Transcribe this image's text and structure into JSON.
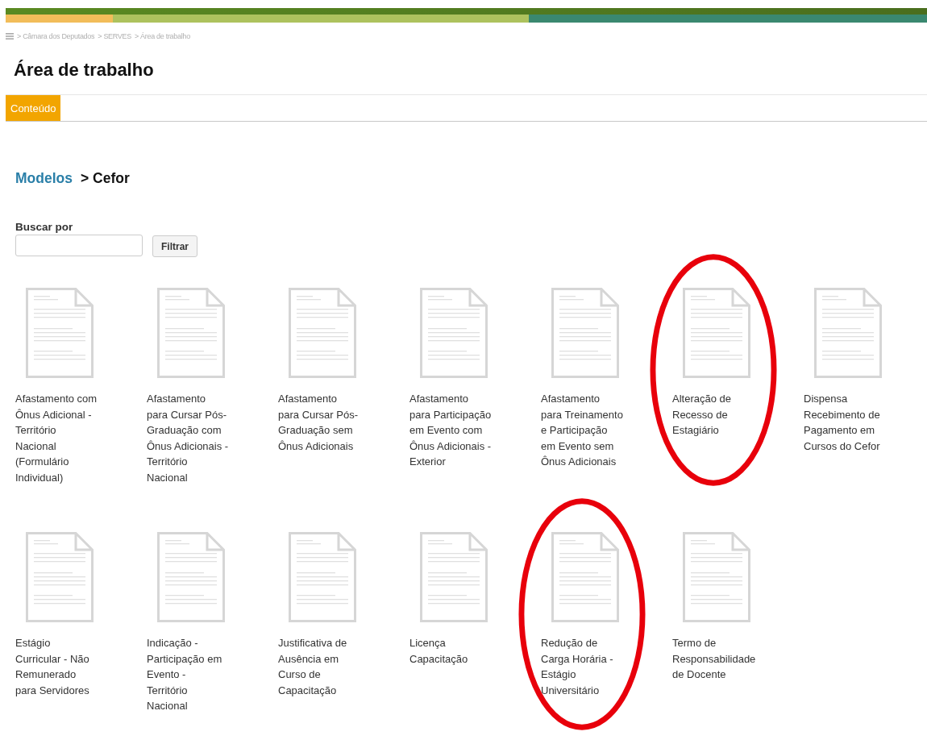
{
  "breadcrumb": [
    "> Câmara dos Deputados",
    "> SERVES",
    "> Área de trabalho"
  ],
  "title": "Área de trabalho",
  "tabs": [
    {
      "label": "Conteúdo",
      "selected": true
    }
  ],
  "path": {
    "link": "Modelos",
    "current": "> Cefor"
  },
  "search": {
    "label": "Buscar por",
    "button": "Filtrar"
  },
  "documents": [
    {
      "label": "Afastamento com Ônus Adicional - Território Nacional (Formulário Individual)",
      "circled": false
    },
    {
      "label": "Afastamento para Cursar Pós-Graduação com Ônus Adicionais - Território Nacional",
      "circled": false
    },
    {
      "label": "Afastamento para Cursar Pós-Graduação sem Ônus Adicionais",
      "circled": false
    },
    {
      "label": "Afastamento para Participação em Evento com Ônus Adicionais - Exterior",
      "circled": false
    },
    {
      "label": "Afastamento para Treinamento e Participação em Evento sem Ônus Adicionais",
      "circled": false
    },
    {
      "label": "Alteração de Recesso de Estagiário",
      "circled": true
    },
    {
      "label": "Dispensa Recebimento de Pagamento em Cursos do Cefor",
      "circled": false
    },
    {
      "label": "Estágio Curricular - Não Remunerado para Servidores",
      "circled": false
    },
    {
      "label": "Indicação - Participação em Evento - Território Nacional",
      "circled": false
    },
    {
      "label": "Justificativa de Ausência em Curso de Capacitação",
      "circled": false
    },
    {
      "label": "Licença Capacitação",
      "circled": false
    },
    {
      "label": "Redução de Carga Horária - Estágio Universitário",
      "circled": true
    },
    {
      "label": "Termo de Responsabilidade de Docente",
      "circled": false
    }
  ]
}
